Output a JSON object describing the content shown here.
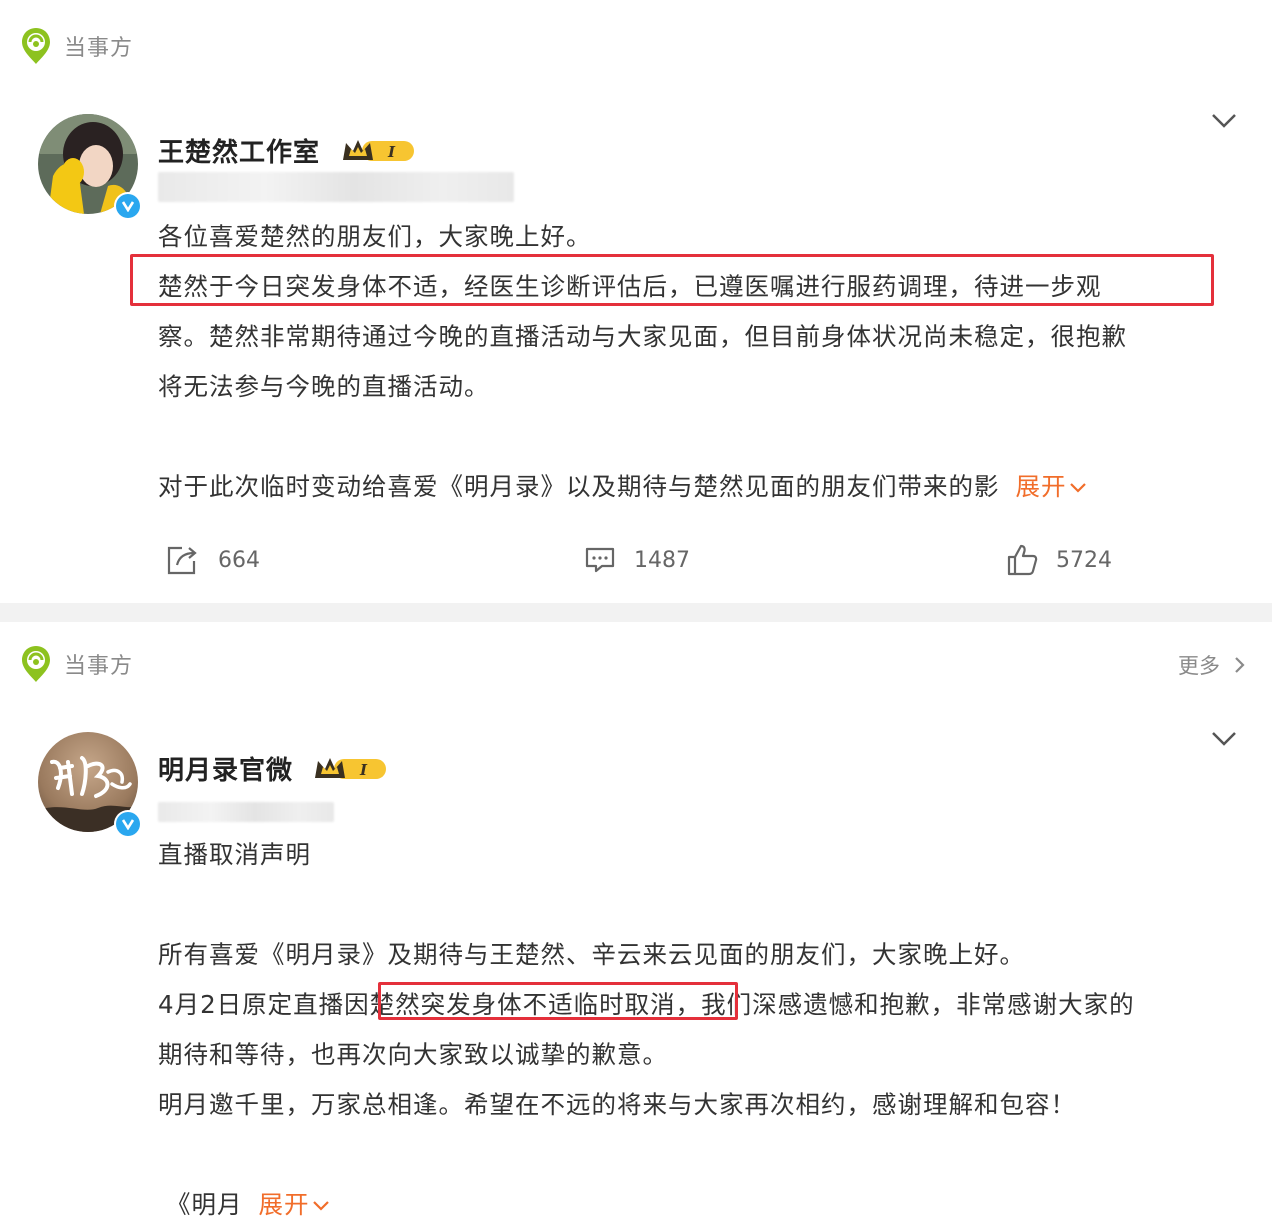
{
  "posts": [
    {
      "source": {
        "label": "当事方",
        "icon": "location-pin-icon"
      },
      "author": {
        "name": "王楚然工作室",
        "badge_text": "I"
      },
      "body_lines": [
        "各位喜爱楚然的朋友们，大家晚上好。",
        "楚然于今日突发身体不适，经医生诊断评估后，已遵医嘱进行服药调理，待进一步观",
        "察。楚然非常期待通过今晚的直播活动与大家见面，但目前身体状况尚未稳定，很抱歉",
        "将无法参与今晚的直播活动。",
        "对于此次临时变动给喜爱《明月录》以及期待与楚然见面的朋友们带来的影"
      ],
      "expand_label": "展开",
      "actions": {
        "repost_count": "664",
        "comment_count": "1487",
        "like_count": "5724"
      }
    },
    {
      "source": {
        "label": "当事方",
        "icon": "location-pin-icon",
        "more_label": "更多"
      },
      "author": {
        "name": "明月录官微",
        "badge_text": "I"
      },
      "body_lines": [
        "直播取消声明",
        "所有喜爱《明月录》及期待与王楚然、辛云来云见面的朋友们，大家晚上好。",
        "4月2日原定直播因楚然突发身体不适临时取消，我们深感遗憾和抱歉，非常感谢大家的",
        "期待和等待，也再次向大家致以诚挚的歉意。",
        "明月邀千里，万家总相逢。希望在不远的将来与大家再次相约，感谢理解和包容！",
        "《明月"
      ],
      "expand_label": "展开"
    }
  ],
  "colors": {
    "highlight": "#e4303b",
    "expand": "#f16d2a",
    "verified": "#2aa7ef",
    "source_icon": "#8dc21f",
    "badge": "#f7c531"
  }
}
